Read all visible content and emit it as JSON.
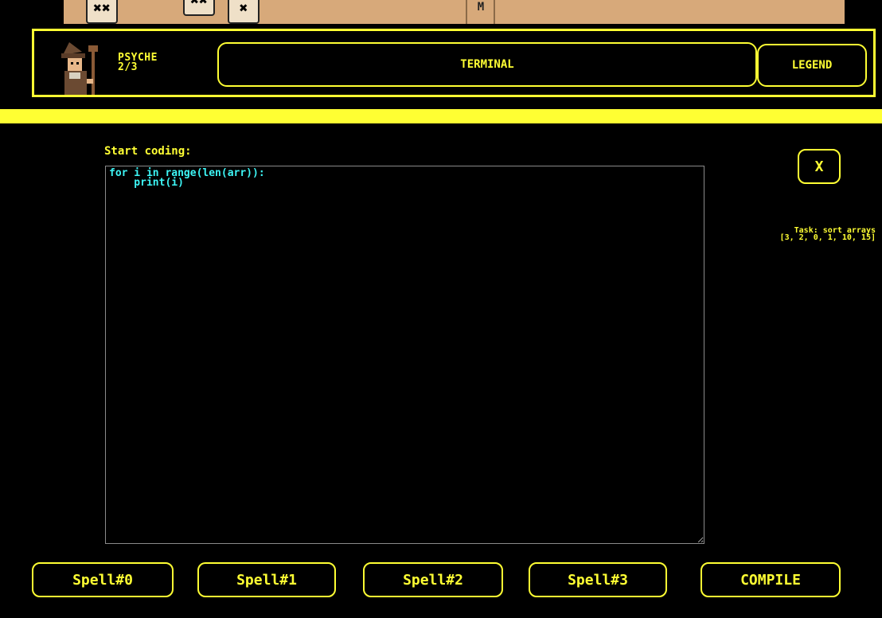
{
  "map": {
    "tiles": [
      "✖✖",
      "✖✖",
      "✖",
      "M"
    ]
  },
  "header": {
    "player_name": "PSYCHE",
    "player_progress": "2/3",
    "terminal_label": "TERMINAL",
    "legend_label": "LEGEND"
  },
  "editor": {
    "prompt": "Start coding:",
    "code": "for i in range(len(arr)):\n    print(i)"
  },
  "close_label": "X",
  "task": {
    "line1": "Task: sort arrays",
    "line2": "[3, 2, 0, 1, 10, 15]"
  },
  "spells": [
    "Spell#0",
    "Spell#1",
    "Spell#2",
    "Spell#3"
  ],
  "compile_label": "COMPILE",
  "colors": {
    "accent": "#ffff33",
    "code": "#3df5f5",
    "background": "#000000",
    "map": "#d7a97a"
  }
}
